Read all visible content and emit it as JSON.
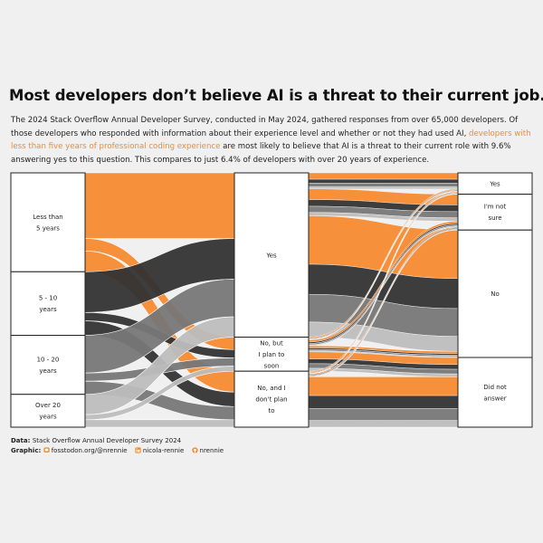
{
  "title": "Most developers don’t believe AI is a threat to their current job.",
  "subtitle": {
    "part1": "The 2024 Stack Overflow Annual Developer Survey, conducted in May 2024, gathered responses from over 65,000 developers. Of those developers who responded with information about their experience level and whether or not they had used AI, ",
    "highlight": "developers with less than five years of professional coding experience",
    "part2": " are most likely to believe that AI is a threat to their current role with 9.6% answering yes to this question. This compares to just 6.4% of developers with over 20 years of experience."
  },
  "caption": {
    "data_label": "Data",
    "data_text": "Stack Overflow Annual Developer Survey 2024",
    "graphic_label": "Graphic",
    "mastodon": "fosstodon.org/@nrennie",
    "linkedin": "nicola-rennie",
    "github": "nrennie"
  },
  "colors": {
    "background": "#f0f0f0",
    "orange": "#f58a30",
    "dark": "#333333",
    "mid": "#777777",
    "light": "#bdbdbd",
    "node_fill": "#ffffff",
    "node_stroke": "#222222"
  },
  "chart_data": {
    "type": "sankey",
    "columns": [
      {
        "name": "experience",
        "nodes": [
          {
            "lines": [
              "Less than",
              "5 years"
            ],
            "color": "#f58a30",
            "value": 38.9
          },
          {
            "lines": [
              "5 - 10",
              "years"
            ],
            "color": "#333333",
            "value": 25.0
          },
          {
            "lines": [
              "10 - 20",
              "years"
            ],
            "color": "#777777",
            "value": 23.2
          },
          {
            "lines": [
              "Over 20",
              "years"
            ],
            "color": "#bdbdbd",
            "value": 12.9
          }
        ]
      },
      {
        "name": "ai_use",
        "nodes": [
          {
            "lines": [
              "Yes"
            ],
            "value": 64.6
          },
          {
            "lines": [
              "No, but",
              "I plan to",
              "soon"
            ],
            "value": 13.4
          },
          {
            "lines": [
              "No, and I",
              "don't plan",
              "to"
            ],
            "value": 22.0
          }
        ]
      },
      {
        "name": "ai_threat",
        "nodes": [
          {
            "lines": [
              "Yes"
            ],
            "value": 8.4
          },
          {
            "lines": [
              "I'm not",
              "sure"
            ],
            "value": 14.1
          },
          {
            "lines": [
              "No"
            ],
            "value": 50.1
          },
          {
            "lines": [
              "Did not",
              "answer"
            ],
            "value": 27.4
          }
        ]
      }
    ],
    "flows_experience_to_ai_use": [
      [
        25.8,
        4.9,
        8.2
      ],
      [
        16.0,
        3.3,
        5.7
      ],
      [
        14.8,
        3.2,
        5.2
      ],
      [
        8.0,
        2.0,
        2.9
      ]
    ],
    "flows_ai_use_to_ai_threat": [
      [
        6.3,
        10.6,
        47.7
      ],
      [
        1.1,
        2.3,
        2.4
      ],
      [
        1.0,
        1.2,
        0.0
      ]
    ]
  }
}
